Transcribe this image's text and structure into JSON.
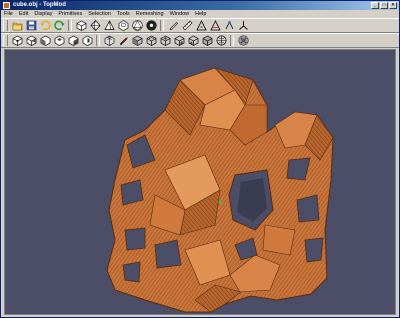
{
  "window": {
    "title": "cube.obj - TopMod"
  },
  "menu": {
    "items": [
      "File",
      "Edit",
      "Display",
      "Primitives",
      "Selection",
      "Tools",
      "Remeshing",
      "Window",
      "Help"
    ]
  },
  "toolbar1": {
    "icons": [
      "open-icon",
      "save-icon",
      "undo-icon",
      "redo-icon",
      "cube-icon",
      "octahedron-icon",
      "tetrahedron-icon",
      "dodecahedron-icon",
      "icosahedron-icon",
      "soccerball-icon",
      "pen-icon",
      "ruler-icon",
      "triangle-icon",
      "triangle-edit-icon",
      "vertex-icon",
      "axes-icon"
    ]
  },
  "toolbar2": {
    "icons": [
      "cube-frame-icon",
      "cube-corner-icon",
      "box-icon",
      "bevel-icon",
      "chamfer-icon",
      "extrude-icon",
      "grid-icon",
      "pencil-icon",
      "cube-solid-icon",
      "cube-solid-2-icon",
      "cube-solid-3-icon",
      "cube-solid-4-icon",
      "cube-solid-5-icon",
      "cube-solid-6-icon",
      "sphere-icon",
      "flower-icon"
    ]
  },
  "viewport": {
    "background_color": "#4b4e66",
    "model_color": "#c8743a",
    "model_shadow_color": "#7a3e14"
  }
}
